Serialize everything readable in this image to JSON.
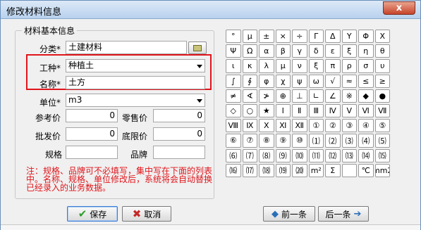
{
  "window": {
    "title": "修改材料信息",
    "close_symbol": "x"
  },
  "group": {
    "title": "材料基本信息"
  },
  "form": {
    "category_label": "分类*",
    "category_value": "土建材料",
    "worktype_label": "工种*",
    "worktype_value": "种植土",
    "name_label": "名称*",
    "name_value": "土方",
    "unit_label": "单位*",
    "unit_value": "m3",
    "ref_price_label": "参考价",
    "ref_price_value": "0",
    "retail_price_label": "零售价",
    "retail_price_value": "0",
    "wholesale_price_label": "批发价",
    "wholesale_price_value": "0",
    "floor_price_label": "底限价",
    "floor_price_value": "0",
    "spec_label": "规格",
    "spec_value": "",
    "brand_label": "品牌",
    "brand_value": ""
  },
  "note": "注：规格、品牌可不必填写，集中写在下面的列表中。名称、规格、单位修改后，系统将会自动替换已经录入的业务数据。",
  "symbols": [
    "°",
    "μ",
    "±",
    "×",
    "÷",
    "Γ",
    "Δ",
    "Υ",
    "Φ",
    "Χ",
    "Ψ",
    "Ω",
    "α",
    "β",
    "γ",
    "δ",
    "ε",
    "ξ",
    "η",
    "θ",
    "ι",
    "κ",
    "λ",
    "μ",
    "ν",
    "ξ",
    "π",
    "ρ",
    "σ",
    "υ",
    "∫",
    "∮",
    "φ",
    "χ",
    "ψ",
    "ω",
    "√",
    "≈",
    "≤",
    "≥",
    "≠",
    "∢",
    "≯",
    "⊕",
    "⊥",
    "∟",
    "∠",
    "※",
    "◆",
    "●",
    "◇",
    "○",
    "★",
    "Ⅰ",
    "Ⅱ",
    "Ⅲ",
    "Ⅳ",
    "Ⅴ",
    "Ⅵ",
    "Ⅶ",
    "Ⅷ",
    "Ⅸ",
    "Ⅹ",
    "Ⅺ",
    "Ⅻ",
    "①",
    "②",
    "③",
    "④",
    "⑤",
    "⑥",
    "⑦",
    "⑧",
    "⑨",
    "⑩",
    "⑴",
    "⑵",
    "⑶",
    "⑷",
    "⑸",
    "⑹",
    "⑺",
    "⑻",
    "⑼",
    "⑽",
    "⑾",
    "⑿",
    "⒀",
    "⒁",
    "⒂",
    "⒃",
    "⒄",
    "⒅",
    "⒆",
    "⒇",
    "m²",
    "Σ",
    "",
    "℃",
    "mm2"
  ],
  "buttons": {
    "save": "保存",
    "cancel": "取消",
    "prev": "前一条",
    "next": "后一条",
    "save_icon": "check-icon",
    "cancel_icon": "x-icon",
    "prev_icon": "arrow-left-icon",
    "next_icon": "arrow-right-icon"
  },
  "colors": {
    "highlight_box": "#e0151b",
    "note_text": "#e0151b"
  }
}
